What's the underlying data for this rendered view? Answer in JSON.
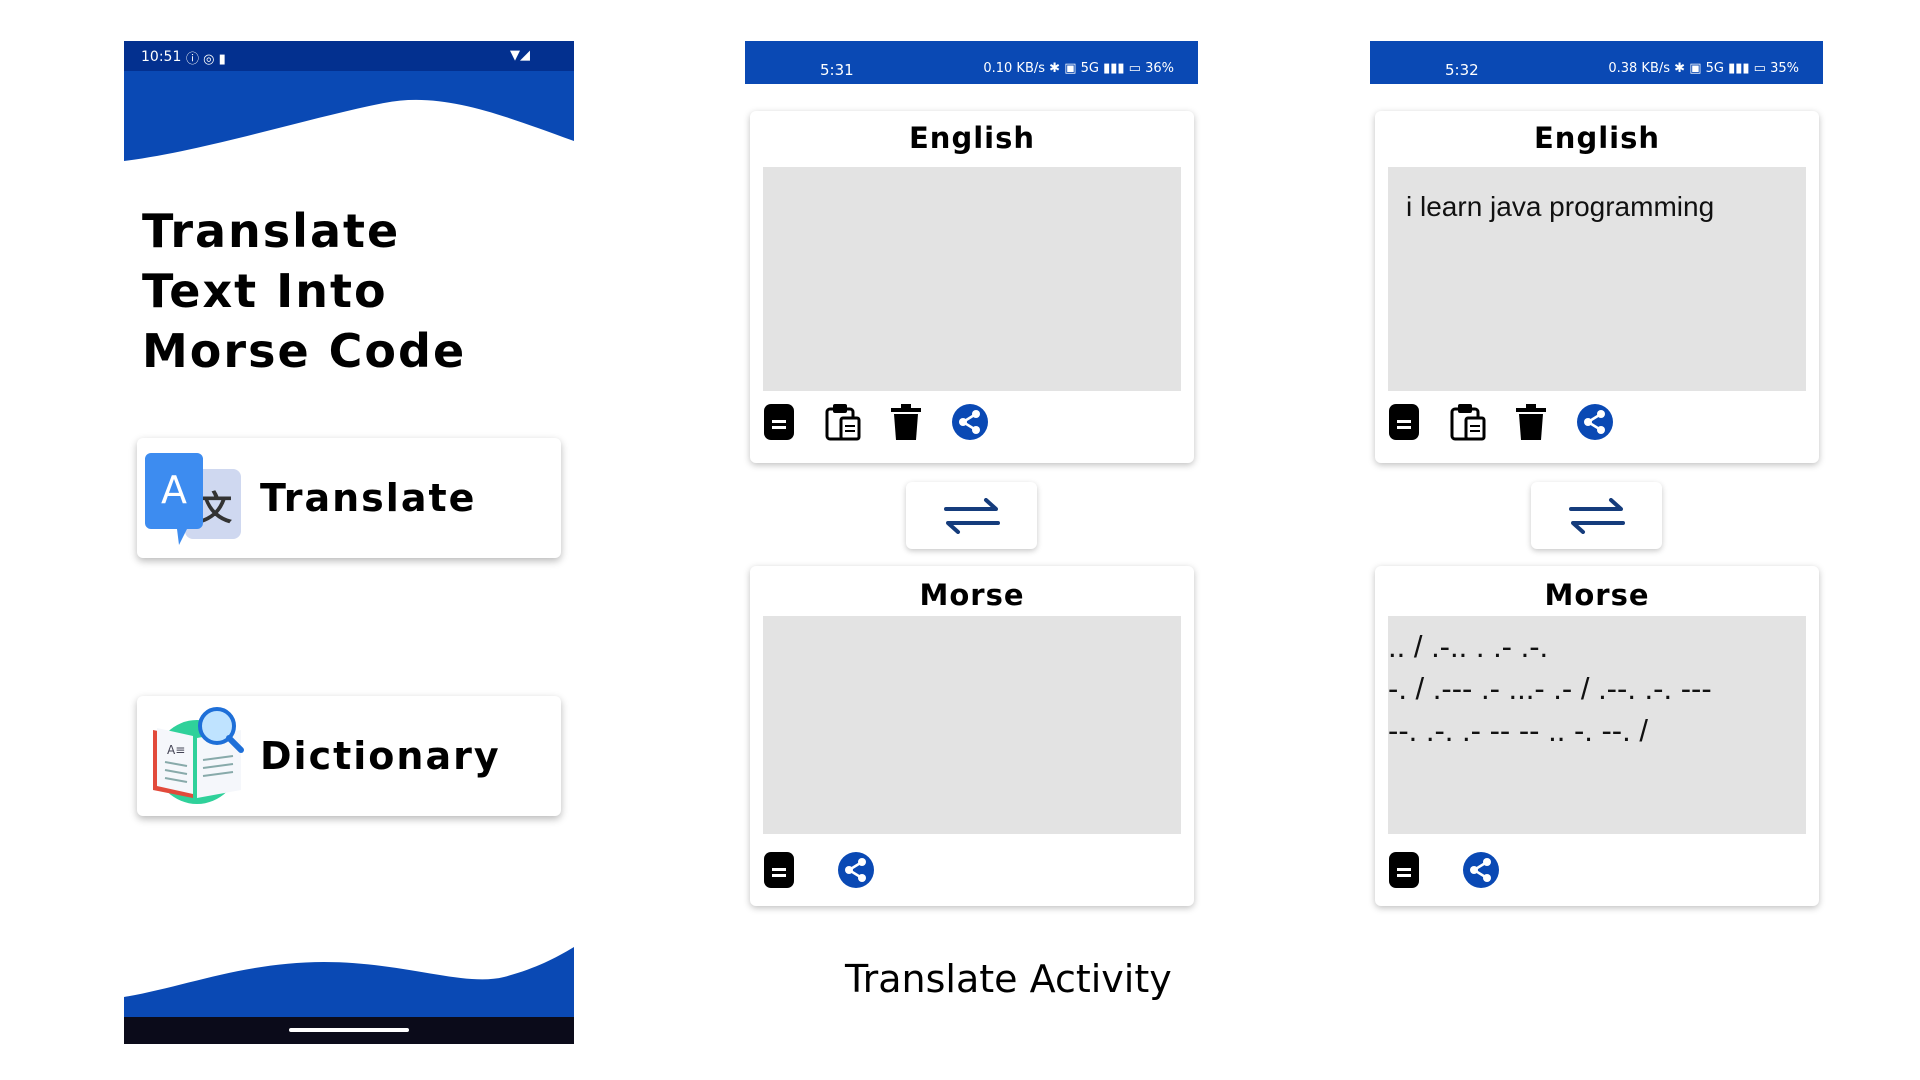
{
  "home": {
    "status_time": "10:51",
    "headline_lines": [
      "Translate",
      "Text Into",
      "Morse Code"
    ],
    "translate_label": "Translate",
    "dictionary_label": "Dictionary"
  },
  "screen_empty": {
    "status_time": "5:31",
    "status_icons": "0.10 KB/s ✱ ▣ 5G ▮▮▮ ▭ 36%",
    "english_title": "English",
    "english_text": "",
    "morse_title": "Morse",
    "morse_text": ""
  },
  "screen_filled": {
    "status_time": "5:32",
    "status_icons": "0.38 KB/s ✱ ▣ 5G ▮▮▮ ▭ 35%",
    "english_title": "English",
    "english_text": "i learn java programming",
    "morse_title": "Morse",
    "morse_text": ".. / .-.. . .- .-.\n-. / .--- .- ...- .- / .--. .-. ---\n--. .-. .- -- -- .. -. --. /"
  },
  "caption": "Translate Activity",
  "colors": {
    "brand_blue": "#0a49b4",
    "dark_blue": "#03308f",
    "field_gray": "#e3e3e3"
  }
}
